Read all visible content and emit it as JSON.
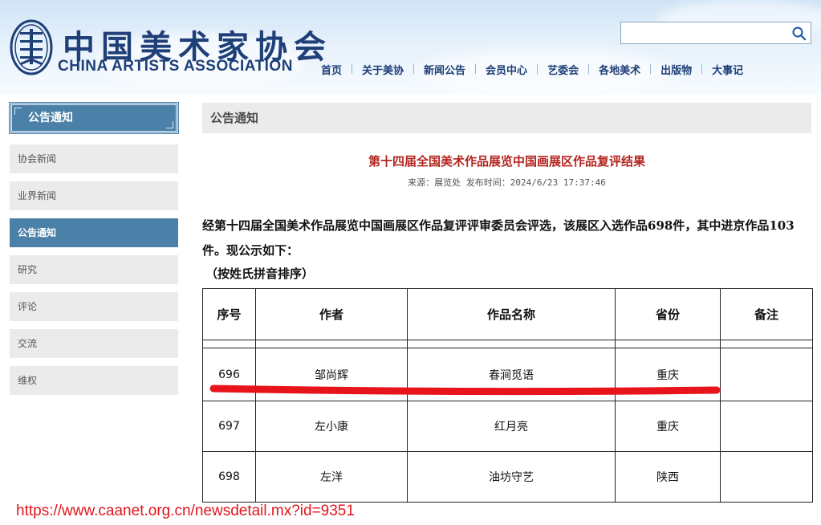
{
  "header": {
    "logo_cn": "中国美术家协会",
    "logo_en": "CHINA ARTISTS ASSOCIATION",
    "search_placeholder": "",
    "nav": [
      "首页",
      "关于美协",
      "新闻公告",
      "会员中心",
      "艺委会",
      "各地美术",
      "出版物",
      "大事记"
    ]
  },
  "sidebar": {
    "title": "公告通知",
    "items": [
      {
        "label": "协会新闻",
        "active": false
      },
      {
        "label": "业界新闻",
        "active": false
      },
      {
        "label": "公告通知",
        "active": true
      },
      {
        "label": "研究",
        "active": false
      },
      {
        "label": "评论",
        "active": false
      },
      {
        "label": "交流",
        "active": false
      },
      {
        "label": "维权",
        "active": false
      }
    ]
  },
  "main": {
    "section_title": "公告通知",
    "article_title": "第十四届全国美术作品展览中国画展区作品复评结果",
    "meta": "来源：展览处 发布时间：2024/6/23 17:37:46",
    "body": "经第十四届全国美术作品展览中国画展区作品复评评审委员会评选，该展区入选作品698件，其中进京作品103件。现公示如下：",
    "sort_note": "（按姓氏拼音排序）",
    "table": {
      "headers": [
        "序号",
        "作者",
        "作品名称",
        "省份",
        "备注"
      ],
      "rows": [
        {
          "no": "696",
          "author": "邹尚辉",
          "title": "春涧觅语",
          "province": "重庆",
          "note": ""
        },
        {
          "no": "697",
          "author": "左小康",
          "title": "红月亮",
          "province": "重庆",
          "note": ""
        },
        {
          "no": "698",
          "author": "左洋",
          "title": "油坊守艺",
          "province": "陕西",
          "note": ""
        }
      ]
    }
  },
  "overlay": {
    "url": "https://www.caanet.org.cn/newsdetail.mx?id=9351",
    "highlight_color": "#e8141c"
  },
  "colors": {
    "accent": "#4b80a8",
    "title_red": "#b3251f",
    "nav_blue": "#1e3f78"
  }
}
